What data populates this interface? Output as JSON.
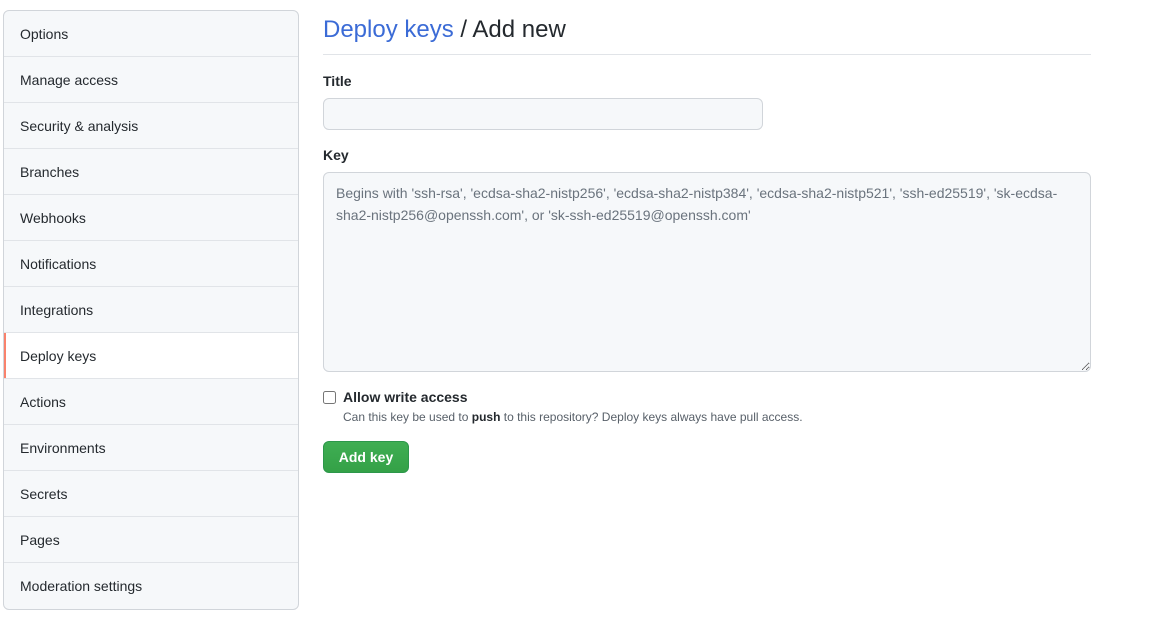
{
  "sidebar": {
    "items": [
      {
        "label": "Options"
      },
      {
        "label": "Manage access"
      },
      {
        "label": "Security & analysis"
      },
      {
        "label": "Branches"
      },
      {
        "label": "Webhooks"
      },
      {
        "label": "Notifications"
      },
      {
        "label": "Integrations"
      },
      {
        "label": "Deploy keys"
      },
      {
        "label": "Actions"
      },
      {
        "label": "Environments"
      },
      {
        "label": "Secrets"
      },
      {
        "label": "Pages"
      },
      {
        "label": "Moderation settings"
      }
    ],
    "selected_label": "Deploy keys"
  },
  "header": {
    "link": "Deploy keys",
    "separator": "/",
    "title": "Add new"
  },
  "form": {
    "title_label": "Title",
    "title_value": "",
    "key_label": "Key",
    "key_placeholder": "Begins with 'ssh-rsa', 'ecdsa-sha2-nistp256', 'ecdsa-sha2-nistp384', 'ecdsa-sha2-nistp521', 'ssh-ed25519', 'sk-ecdsa-sha2-nistp256@openssh.com', or 'sk-ssh-ed25519@openssh.com'",
    "allow_write_label": "Allow write access",
    "allow_write_checked": false,
    "note_before": "Can this key be used to ",
    "note_bold": "push",
    "note_after": " to this repository? Deploy keys always have pull access.",
    "submit_label": "Add key"
  },
  "colors": {
    "accent_link": "#3b6bd6",
    "selected_marker": "#f9826c",
    "primary_button": "#2ea44f"
  }
}
